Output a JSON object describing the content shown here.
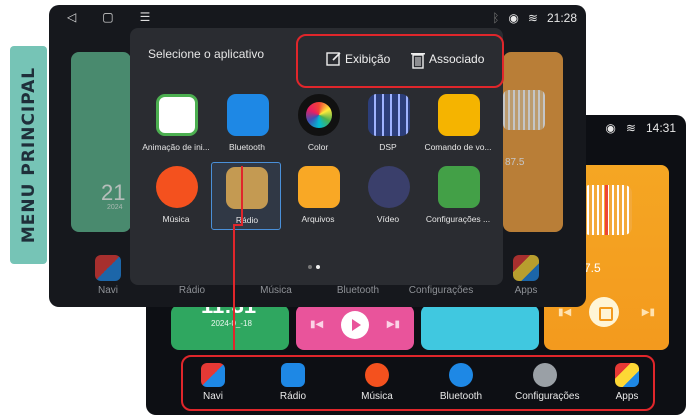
{
  "side_tab": {
    "label": "MENU PRINCIPAL",
    "color": "#76c4b6"
  },
  "front_screen": {
    "status": {
      "time": "21:28",
      "icons": [
        "bluetooth-icon",
        "location-icon",
        "wifi-icon"
      ]
    },
    "nav": {
      "icons": [
        "back-icon",
        "home-icon",
        "menu-icon"
      ]
    },
    "background": {
      "clock_big": "21",
      "clock_date": "2024",
      "radio_freq": "87.5"
    },
    "dock_labels": [
      "Navi",
      "Rádio",
      "Música",
      "Bluetooth",
      "Configurações",
      "Apps"
    ]
  },
  "popup": {
    "title": "Selecione o aplicativo",
    "options": [
      {
        "label": "Exibição",
        "icon": "edit-icon"
      },
      {
        "label": "Associado",
        "icon": "trash-icon"
      }
    ],
    "apps": [
      {
        "label": "Animação de ini...",
        "icon": "boot-animation-icon",
        "color": "#4caf50"
      },
      {
        "label": "Bluetooth",
        "icon": "bluetooth-icon",
        "color": "#1e88e5"
      },
      {
        "label": "Color",
        "icon": "color-wheel-icon",
        "color": "#111111"
      },
      {
        "label": "DSP",
        "icon": "equalizer-icon",
        "color": "#2c3e7a"
      },
      {
        "label": "Comando de vo...",
        "icon": "steering-wheel-icon",
        "color": "#f5b400"
      },
      {
        "label": "Música",
        "icon": "music-disc-icon",
        "color": "#f4511e"
      },
      {
        "label": "Rádio",
        "icon": "radio-icon",
        "color": "#c49a52",
        "selected": true
      },
      {
        "label": "Arquivos",
        "icon": "folder-icon",
        "color": "#f9a825"
      },
      {
        "label": "Vídeo",
        "icon": "video-play-icon",
        "color": "#3a3f6b"
      },
      {
        "label": "Configurações ...",
        "icon": "car-settings-icon",
        "color": "#43a047"
      }
    ],
    "page_dots": 2,
    "active_page": 2
  },
  "back_screen": {
    "status": {
      "time": "14:31",
      "icons": [
        "location-icon",
        "wifi-icon"
      ]
    },
    "clock": {
      "time": "11:31",
      "date": "2024-0_-18"
    },
    "radio": {
      "freq": "M 87.5"
    },
    "dock": [
      {
        "label": "Navi",
        "icon": "navi-icon"
      },
      {
        "label": "Rádio",
        "icon": "radio-icon"
      },
      {
        "label": "Música",
        "icon": "music-icon"
      },
      {
        "label": "Bluetooth",
        "icon": "phone-icon"
      },
      {
        "label": "Configurações",
        "icon": "gear-icon"
      },
      {
        "label": "Apps",
        "icon": "apps-icon"
      }
    ]
  },
  "accent_color": "#e0262b"
}
